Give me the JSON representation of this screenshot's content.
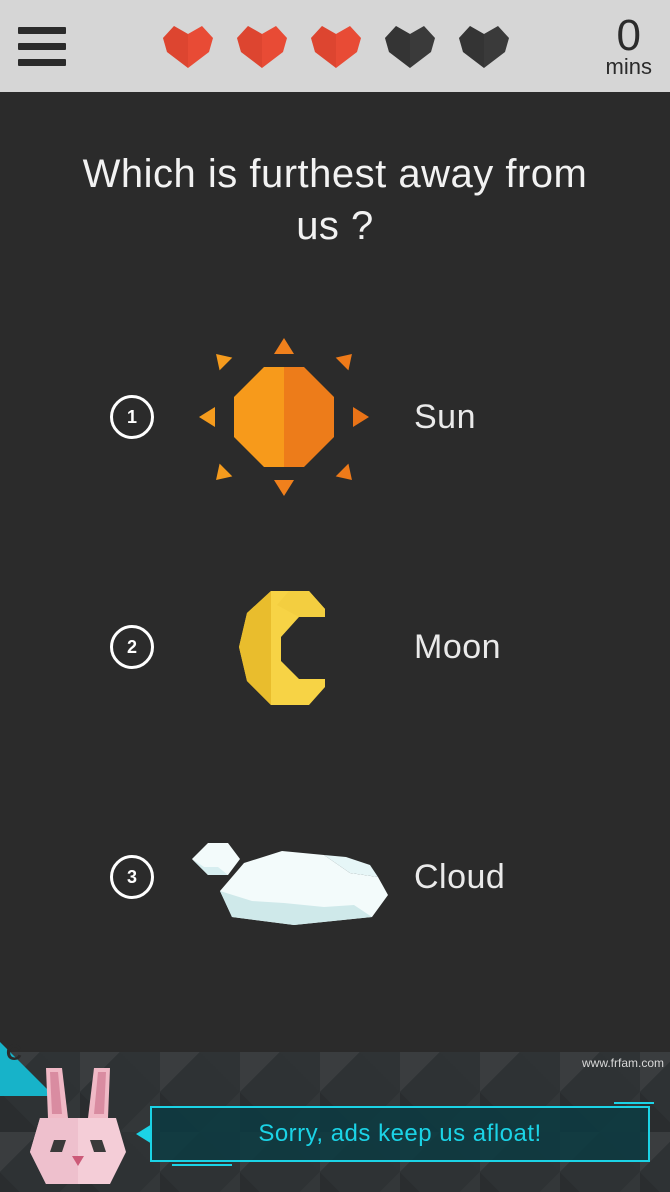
{
  "colors": {
    "accent": "#1bd3e6",
    "heart_full": "#e84b35",
    "heart_empty": "#3a3a3a",
    "sun_light": "#f79a1b",
    "sun_dark": "#ed7c1a",
    "moon_light": "#f7d345",
    "moon_dark": "#e9bd2d",
    "cloud_light": "#f3fbfb",
    "cloud_shadow": "#cfe9ea"
  },
  "header": {
    "hearts_total": 5,
    "hearts_full": 3,
    "timer_value": "0",
    "timer_unit": "mins"
  },
  "question": "Which is furthest away from us ?",
  "options": [
    {
      "num": "1",
      "label": "Sun",
      "icon": "sun-icon"
    },
    {
      "num": "2",
      "label": "Moon",
      "icon": "moon-icon"
    },
    {
      "num": "3",
      "label": "Cloud",
      "icon": "cloud-icon"
    }
  ],
  "hint_letter": "C",
  "speech": "Sorry, ads keep us afloat!",
  "watermark": "www.frfam.com"
}
